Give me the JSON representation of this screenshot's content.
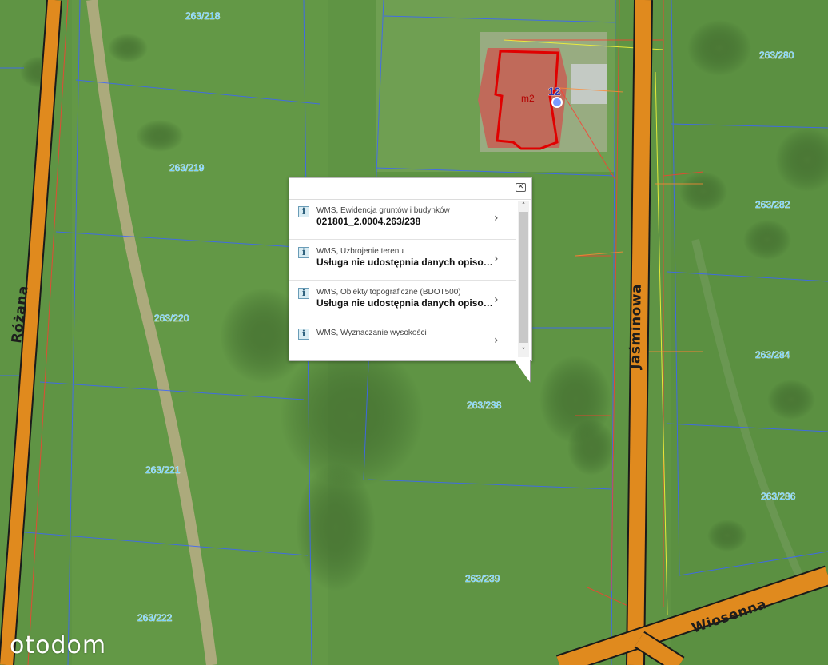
{
  "map": {
    "parcels": [
      "263/218",
      "263/219",
      "263/220",
      "263/221",
      "263/222",
      "263/238",
      "263/239",
      "263/280",
      "263/282",
      "263/284",
      "263/286"
    ],
    "streets": [
      "Różana",
      "Jaśminowa",
      "Wiosenna"
    ],
    "building_label": "m2",
    "address_number": "12"
  },
  "popup": {
    "items": [
      {
        "title": "WMS, Ewidencja gruntów i budynków",
        "value": "021801_2.0004.263/238"
      },
      {
        "title": "WMS, Uzbrojenie terenu",
        "value": "Usługa nie udostępnia danych opisowych"
      },
      {
        "title": "WMS, Obiekty topograficzne (BDOT500)",
        "value": "Usługa nie udostępnia danych opisowych"
      },
      {
        "title": "WMS, Wyznaczanie wysokości",
        "value": ""
      }
    ],
    "info_icon": "info-icon",
    "close_icon": "close-icon"
  },
  "brand": "otodom"
}
